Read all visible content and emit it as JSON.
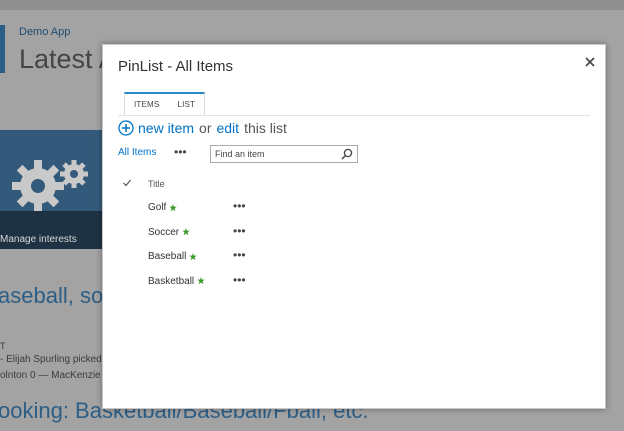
{
  "background": {
    "site_name": "Demo App",
    "page_title": "Latest A",
    "tile_label": "Manage interests",
    "heading_1": "aseball, so",
    "small_line_1": "T",
    "small_line_2": "- Elijah Spurling picked",
    "small_line_3": "olnton 0 — MacKenzie",
    "heading_2": "ooking: Basketball/Baseball/Fball, etc."
  },
  "dialog": {
    "title": "PinList - All Items",
    "close_icon": "close-icon",
    "ribbon_tabs": [
      "ITEMS",
      "LIST"
    ],
    "new_item_link": "new item",
    "or_text": "or",
    "edit_link": "edit",
    "this_list_text": "this list",
    "view_name": "All Items",
    "view_menu": "•••",
    "search_placeholder": "Find an item",
    "column_title": "Title",
    "items": [
      {
        "title": "Golf",
        "is_new": true,
        "menu": "•••"
      },
      {
        "title": "Soccer",
        "is_new": true,
        "menu": "•••"
      },
      {
        "title": "Baseball",
        "is_new": true,
        "menu": "•••"
      },
      {
        "title": "Basketball",
        "is_new": true,
        "menu": "•••"
      }
    ]
  },
  "colors": {
    "accent_blue": "#0072c6",
    "tab_accent": "#2b88c8",
    "new_badge_green": "#3a9a2a",
    "tile_blue": "#345a7b"
  }
}
